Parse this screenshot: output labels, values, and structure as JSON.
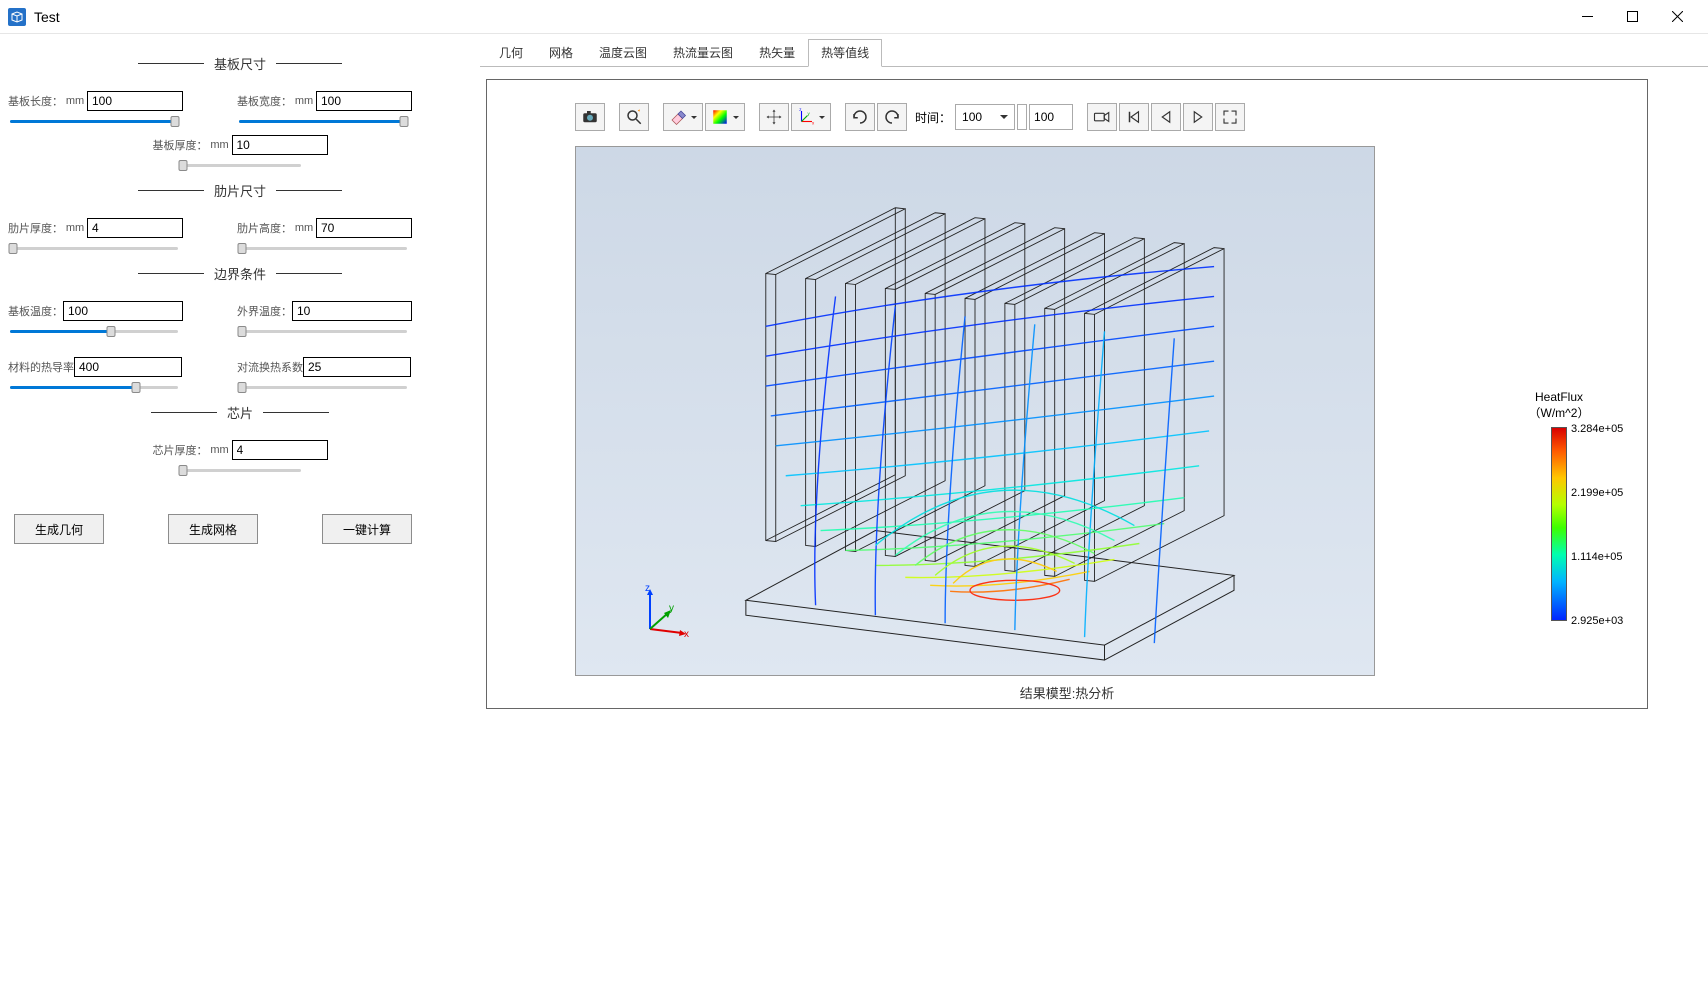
{
  "window": {
    "title": "Test"
  },
  "sections": {
    "base": "基板尺寸",
    "fin": "肋片尺寸",
    "bc": "边界条件",
    "chip": "芯片"
  },
  "fields": {
    "base_length": {
      "label": "基板长度：",
      "unit": "mm",
      "value": "100",
      "slider_pct": 98
    },
    "base_width": {
      "label": "基板宽度：",
      "unit": "mm",
      "value": "100",
      "slider_pct": 98
    },
    "base_thick": {
      "label": "基板厚度：",
      "unit": "mm",
      "value": "10",
      "slider_pct": 2
    },
    "fin_thick": {
      "label": "肋片厚度：",
      "unit": "mm",
      "value": "4",
      "slider_pct": 2
    },
    "fin_height": {
      "label": "肋片高度：",
      "unit": "mm",
      "value": "70",
      "slider_pct": 2
    },
    "base_temp": {
      "label": "基板温度：",
      "unit": "",
      "value": "100",
      "slider_pct": 60
    },
    "amb_temp": {
      "label": "外界温度：",
      "unit": "",
      "value": "10",
      "slider_pct": 2
    },
    "conductivity": {
      "label": "材料的热导率",
      "unit": "",
      "value": "400",
      "slider_pct": 75
    },
    "convection": {
      "label": "对流换热系数",
      "unit": "",
      "value": "25",
      "slider_pct": 2
    },
    "chip_thick": {
      "label": "芯片厚度：",
      "unit": "mm",
      "value": "4",
      "slider_pct": 2
    }
  },
  "buttons": {
    "gen_geom": "生成几何",
    "gen_mesh": "生成网格",
    "one_click": "一键计算"
  },
  "tabs": [
    "几何",
    "网格",
    "温度云图",
    "热流量云图",
    "热矢量",
    "热等值线"
  ],
  "active_tab": 5,
  "toolbar": {
    "time_label": "时间：",
    "time_select": "100",
    "time_spin": "100"
  },
  "legend": {
    "title1": "HeatFlux",
    "title2": "（W/m^2）",
    "ticks": [
      "3.284e+05",
      "2.199e+05",
      "1.114e+05",
      "2.925e+03"
    ]
  },
  "result_label": "结果模型:热分析",
  "axes": {
    "x": "x",
    "y": "y",
    "z": "z"
  }
}
